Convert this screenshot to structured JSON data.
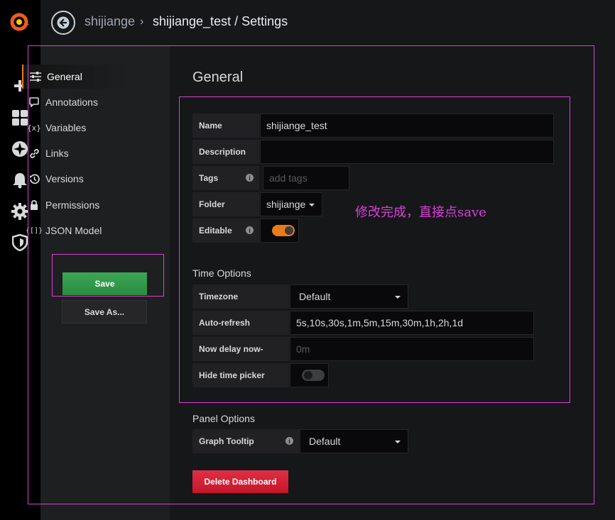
{
  "breadcrumb": {
    "parent": "shijiange",
    "separator": "›",
    "title": "shijiange_test / Settings"
  },
  "sidemenu": {
    "icons": [
      "grafana-logo",
      "plus-icon",
      "dashboards-icon",
      "explore-icon",
      "alerting-icon",
      "gear-icon",
      "shield-icon"
    ]
  },
  "settings_nav": {
    "items": [
      {
        "label": "General",
        "icon": "sliders-icon",
        "active": true
      },
      {
        "label": "Annotations",
        "icon": "comment-icon"
      },
      {
        "label": "Variables",
        "icon": "variable-icon"
      },
      {
        "label": "Links",
        "icon": "link-icon"
      },
      {
        "label": "Versions",
        "icon": "history-icon"
      },
      {
        "label": "Permissions",
        "icon": "lock-icon"
      },
      {
        "label": "JSON Model",
        "icon": "json-icon"
      }
    ],
    "save_label": "Save",
    "save_as_label": "Save As..."
  },
  "general": {
    "heading": "General",
    "name_label": "Name",
    "name_value": "shijiange_test",
    "description_label": "Description",
    "description_value": "",
    "tags_label": "Tags",
    "tags_placeholder": "add tags",
    "folder_label": "Folder",
    "folder_value": "shijiange",
    "editable_label": "Editable",
    "editable_on": true
  },
  "time_options": {
    "heading": "Time Options",
    "timezone_label": "Timezone",
    "timezone_value": "Default",
    "autorefresh_label": "Auto-refresh",
    "autorefresh_value": "5s,10s,30s,1m,5m,15m,30m,1h,2h,1d",
    "nowdelay_label": "Now delay now-",
    "nowdelay_placeholder": "0m",
    "hidepicker_label": "Hide time picker",
    "hidepicker_on": false
  },
  "panel_options": {
    "heading": "Panel Options",
    "tooltip_label": "Graph Tooltip",
    "tooltip_value": "Default"
  },
  "delete_label": "Delete Dashboard",
  "annotation_note": "修改完成，直接点save",
  "colors": {
    "accent": "#eb7b18",
    "save": "#2b8c41",
    "delete": "#d11d34",
    "annotation": "#d940d9"
  }
}
